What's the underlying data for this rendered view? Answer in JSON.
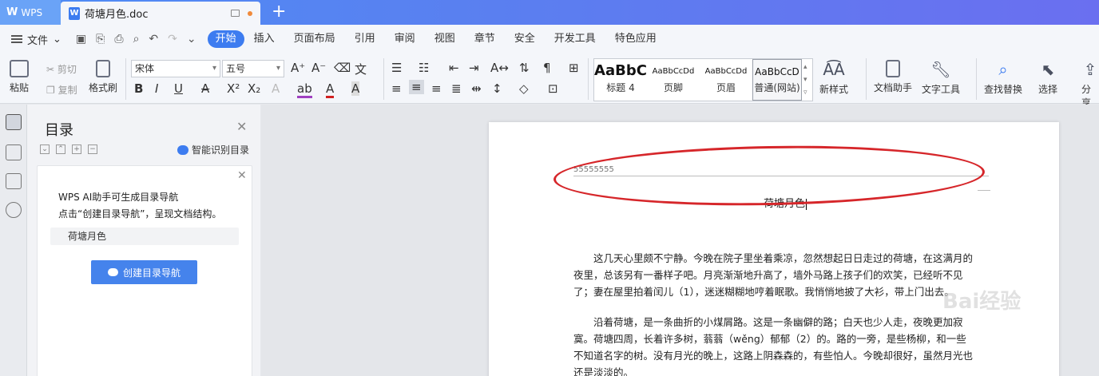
{
  "titlebar": {
    "app_tab": "WPS",
    "doc_tab": "荷塘月色.doc",
    "new_tab_symbol": "+"
  },
  "menubar": {
    "file": "文件",
    "tabs": [
      "开始",
      "插入",
      "页面布局",
      "引用",
      "审阅",
      "视图",
      "章节",
      "安全",
      "开发工具",
      "特色应用"
    ],
    "active_tab": "开始"
  },
  "ribbon": {
    "paste": "粘贴",
    "cut": "剪切",
    "copy": "复制",
    "format_painter": "格式刷",
    "font_name": "宋体",
    "font_size": "五号",
    "styles": [
      {
        "sample": "AaBbC",
        "name": "标题 4"
      },
      {
        "sample": "AaBbCcDd",
        "name": "页脚"
      },
      {
        "sample": "AaBbCcDd",
        "name": "页眉"
      },
      {
        "sample": "AaBbCcD",
        "name": "普通(网站)"
      }
    ],
    "new_style": "新样式",
    "doc_assistant": "文档助手",
    "text_tools": "文字工具",
    "find_replace": "查找替换",
    "select": "选择",
    "share": "分享"
  },
  "nav": {
    "title": "目录",
    "smart_detect": "智能识别目录",
    "ai_line1": "WPS AI助手可生成目录导航",
    "ai_line2": "点击“创建目录导航”，呈现文档结构。",
    "toc_item": "荷塘月色",
    "create_button": "创建目录导航"
  },
  "document": {
    "header_text": "55555555",
    "title": "荷塘月色",
    "paragraphs": [
      "这几天心里颇不宁静。今晚在院子里坐着乘凉，忽然想起日日走过的荷塘，在这满月的夜里，总该另有一番样子吧。月亮渐渐地升高了，墙外马路上孩子们的欢笑，已经听不见了；妻在屋里拍着闰儿（1），迷迷糊糊地哼着眠歌。我悄悄地披了大衫，带上门出去。",
      "沿着荷塘，是一条曲折的小煤屑路。这是一条幽僻的路；白天也少人走，夜晚更加寂寞。荷塘四周，长着许多树，蓊蓊（wěng）郁郁（2）的。路的一旁，是些杨柳，和一些不知道名字的树。没有月光的晚上，这路上阴森森的，有些怕人。今晚却很好，虽然月光也还是淡淡的。"
    ]
  },
  "watermark": "Bai经验",
  "colors": {
    "accent": "#3d7cf0",
    "annotation": "#d6262a"
  }
}
